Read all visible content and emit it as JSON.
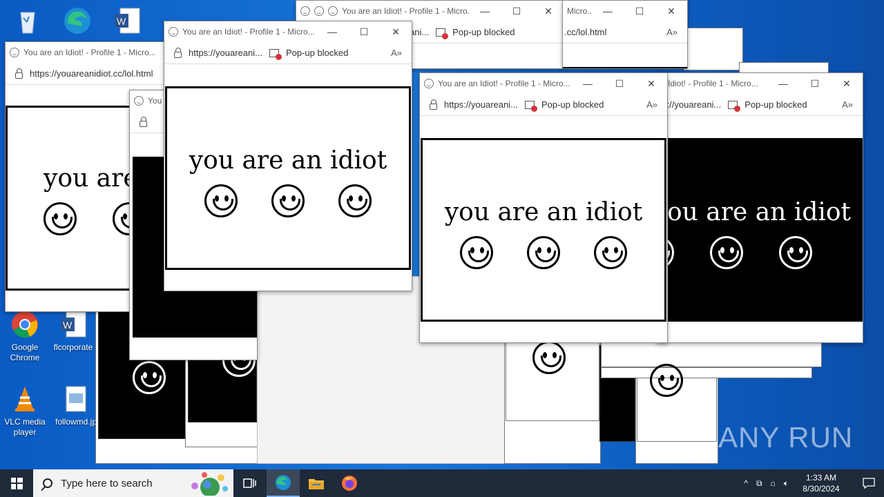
{
  "desktop": {
    "icons": [
      {
        "label": "Google Chrome"
      },
      {
        "label": "flcorporate"
      },
      {
        "label": "VLC media player"
      },
      {
        "label": "followmd.jp"
      }
    ]
  },
  "popups": {
    "title": "You are an Idiot! - Profile 1 - Micro...",
    "title_short": "You",
    "title_cut": "You are an Idiot! - Profile 1 - Micro",
    "title_tail": "Micro...",
    "title_right": "Idiot! - Profile 1 - Micro...",
    "url_full": "https://youareanidiot.cc/lol.html",
    "url_short": "https://youareani...",
    "url_tail": ".cc/lol.html",
    "url_right": "s://youareani...",
    "url_ani": "ani...",
    "popup_blocked": "Pop-up blocked",
    "message": "you are an idiot",
    "message_cut": "you are",
    "message_right": "ou are an idiot"
  },
  "taskbar": {
    "search_placeholder": "Type here to search",
    "time": "1:33 AM",
    "date": "8/30/2024"
  },
  "watermark": "ANY RUN"
}
